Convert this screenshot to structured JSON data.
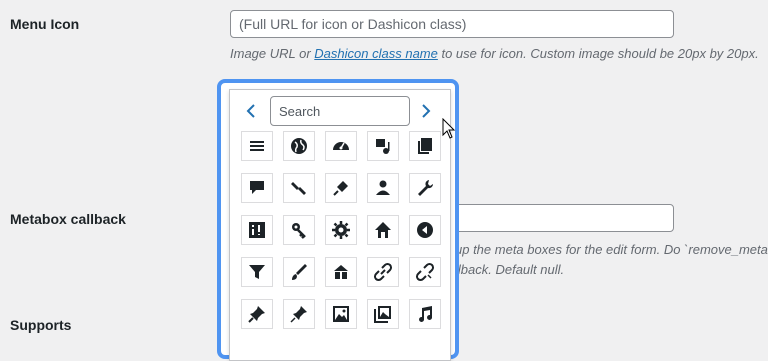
{
  "menu_icon": {
    "label": "Menu Icon",
    "placeholder": "(Full URL for icon or Dashicon class)",
    "desc_prefix": "Image URL or ",
    "desc_link": "Dashicon class name",
    "desc_suffix": " to use for icon. Custom image should be 20px by 20px."
  },
  "metabox": {
    "label": "Metabox callback",
    "desc_line1": "up the meta boxes for the edit form. Do `remove_meta",
    "desc_line2": "llback. Default null."
  },
  "supports": {
    "label": "Supports"
  },
  "picker": {
    "search_placeholder": "Search",
    "prev_label": "‹",
    "next_label": "›",
    "icons": [
      "menu-icon",
      "admin-site-icon",
      "dashboard-icon",
      "admin-media-icon",
      "admin-page-icon",
      "admin-comments-icon",
      "admin-appearance-icon",
      "admin-plugins-icon",
      "admin-users-icon",
      "admin-tools-icon",
      "admin-settings-icon",
      "admin-network-icon",
      "admin-generic-icon",
      "admin-home-icon",
      "admin-collapse-icon",
      "filter-icon",
      "admin-customizer-icon",
      "admin-multisite-icon",
      "admin-links-icon",
      "editor-unlink-icon",
      "admin-post-icon",
      "sticky-icon",
      "format-image-icon",
      "format-gallery-icon",
      "format-audio-icon"
    ]
  }
}
